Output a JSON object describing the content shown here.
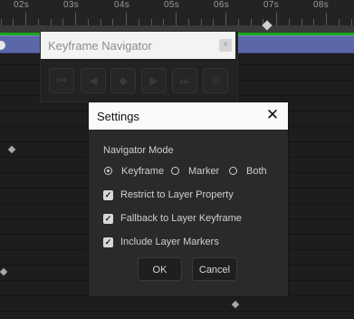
{
  "ruler": {
    "labels": [
      "02s",
      "03s",
      "04s",
      "05s",
      "06s",
      "07s",
      "08s"
    ]
  },
  "navigator": {
    "title": "Keyframe Navigator",
    "close_glyph": "×",
    "buttons": [
      {
        "name": "first-keyframe-button",
        "glyph": "⏮"
      },
      {
        "name": "prev-keyframe-button",
        "glyph": "◀"
      },
      {
        "name": "add-keyframe-button",
        "glyph": "◆"
      },
      {
        "name": "next-keyframe-button",
        "glyph": "▶"
      },
      {
        "name": "last-keyframe-button",
        "glyph": "⏭"
      },
      {
        "name": "settings-gear-button",
        "glyph": "⚙"
      }
    ]
  },
  "settings": {
    "title": "Settings",
    "close_glyph": "✕",
    "mode_label": "Navigator Mode",
    "modes": [
      {
        "label": "Keyframe",
        "checked": true
      },
      {
        "label": "Marker",
        "checked": false
      },
      {
        "label": "Both",
        "checked": false
      }
    ],
    "checks": [
      {
        "label": "Restrict to Layer Property",
        "checked": true
      },
      {
        "label": "Fallback to Layer Keyframe",
        "checked": true
      },
      {
        "label": "Include Layer Markers",
        "checked": true
      }
    ],
    "ok_label": "OK",
    "cancel_label": "Cancel"
  },
  "colors": {
    "layer_bar": "#5b67a8",
    "work_area_green": "#19a81c",
    "panel_bg": "#2a2a2a"
  }
}
